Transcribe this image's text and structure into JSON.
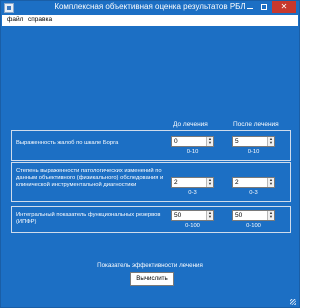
{
  "window": {
    "title": "Комплексная объективная оценка результатов РБЛ",
    "accent": "#1c6fc4",
    "close_color": "#c7382d"
  },
  "menu": {
    "file": "файл",
    "help": "справка"
  },
  "columns": {
    "before": "До лечения",
    "after": "После лечения"
  },
  "rows": [
    {
      "label": "Выраженность жалоб по шкале Борга",
      "before_value": "0",
      "after_value": "5",
      "range": "0-10"
    },
    {
      "label": "Степень выраженности патологических изменений по данным объективного (физикального) обследования и клинической инструментальной диагностики",
      "before_value": "2",
      "after_value": "2",
      "range": "0-3"
    },
    {
      "label": "Интегральный показатель функциональных резервов (ИПФР)",
      "before_value": "50",
      "after_value": "50",
      "range": "0-100"
    }
  ],
  "result_label": "Показатель эффективности лечения",
  "calculate_button": "Вычислить"
}
